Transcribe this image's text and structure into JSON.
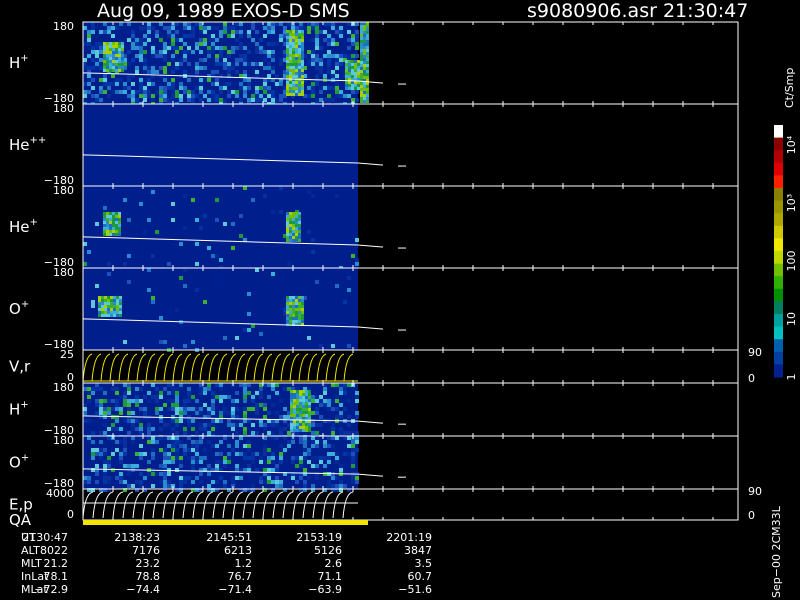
{
  "header": {
    "title": "Aug 09, 1989   EXOS-D SMS",
    "file_time": "s9080906.asr  21:30:47"
  },
  "colorbar": {
    "unit": "Ct/Smp",
    "tick_labels": [
      "10⁴",
      "10³",
      "100",
      "10",
      "1"
    ],
    "colors": [
      "#ffffff",
      "#8b0000",
      "#b00000",
      "#e00000",
      "#ff2000",
      "#8b8000",
      "#9b9500",
      "#b0a800",
      "#d0c800",
      "#f0e800",
      "#c0d800",
      "#70c000",
      "#30b000",
      "#009000",
      "#008060",
      "#00a0a0",
      "#00c0c0",
      "#0060b0",
      "#0040a0",
      "#002090"
    ]
  },
  "chart_data": {
    "type": "heatmap",
    "title": "Aug 09, 1989   EXOS-D SMS",
    "file": "s9080906.asr",
    "time": "21:30:47",
    "panels": [
      {
        "key": "h1",
        "label": "H",
        "sup": "+",
        "ymax": "180",
        "ymin": "−180"
      },
      {
        "key": "he2",
        "label": "He",
        "sup": "++",
        "ymax": "180",
        "ymin": "−180"
      },
      {
        "key": "he1",
        "label": "He",
        "sup": "+",
        "ymax": "180",
        "ymin": "−180"
      },
      {
        "key": "o1",
        "label": "O",
        "sup": "+",
        "ymax": "180",
        "ymin": "−180"
      },
      {
        "key": "vr",
        "label": "V,r",
        "ymax": "25",
        "ymin": "0",
        "rmax": "90",
        "rmin": "0"
      },
      {
        "key": "h2",
        "label": "H",
        "sup": "+",
        "ymax": "180",
        "ymin": "−180"
      },
      {
        "key": "o2",
        "label": "O",
        "sup": "+",
        "ymax": "180",
        "ymin": "−180"
      },
      {
        "key": "ep",
        "label": "E,p",
        "ymax": "4000",
        "ymin": "0",
        "rmax": "90",
        "rmin": "0"
      }
    ],
    "qa_label": "QA",
    "data_coverage_fraction": 0.42,
    "orbit_table": {
      "rows": [
        {
          "label": "UT",
          "values": [
            "2130:47",
            "2138:23",
            "2145:51",
            "2153:19",
            "2201:19"
          ]
        },
        {
          "label": "ALT",
          "values": [
            "8022",
            "7176",
            "6213",
            "5126",
            "3847"
          ]
        },
        {
          "label": "MLT",
          "values": [
            "21.2",
            "23.2",
            "1.2",
            "2.6",
            "3.5"
          ]
        },
        {
          "label": "InLat",
          "values": [
            "78.1",
            "78.8",
            "76.7",
            "71.1",
            "60.7"
          ]
        },
        {
          "label": "MLat",
          "values": [
            "−72.9",
            "−74.4",
            "−71.4",
            "−63.9",
            "−51.6"
          ]
        }
      ]
    }
  },
  "footer": {
    "side_note": "Sep−00  2CM33L"
  }
}
